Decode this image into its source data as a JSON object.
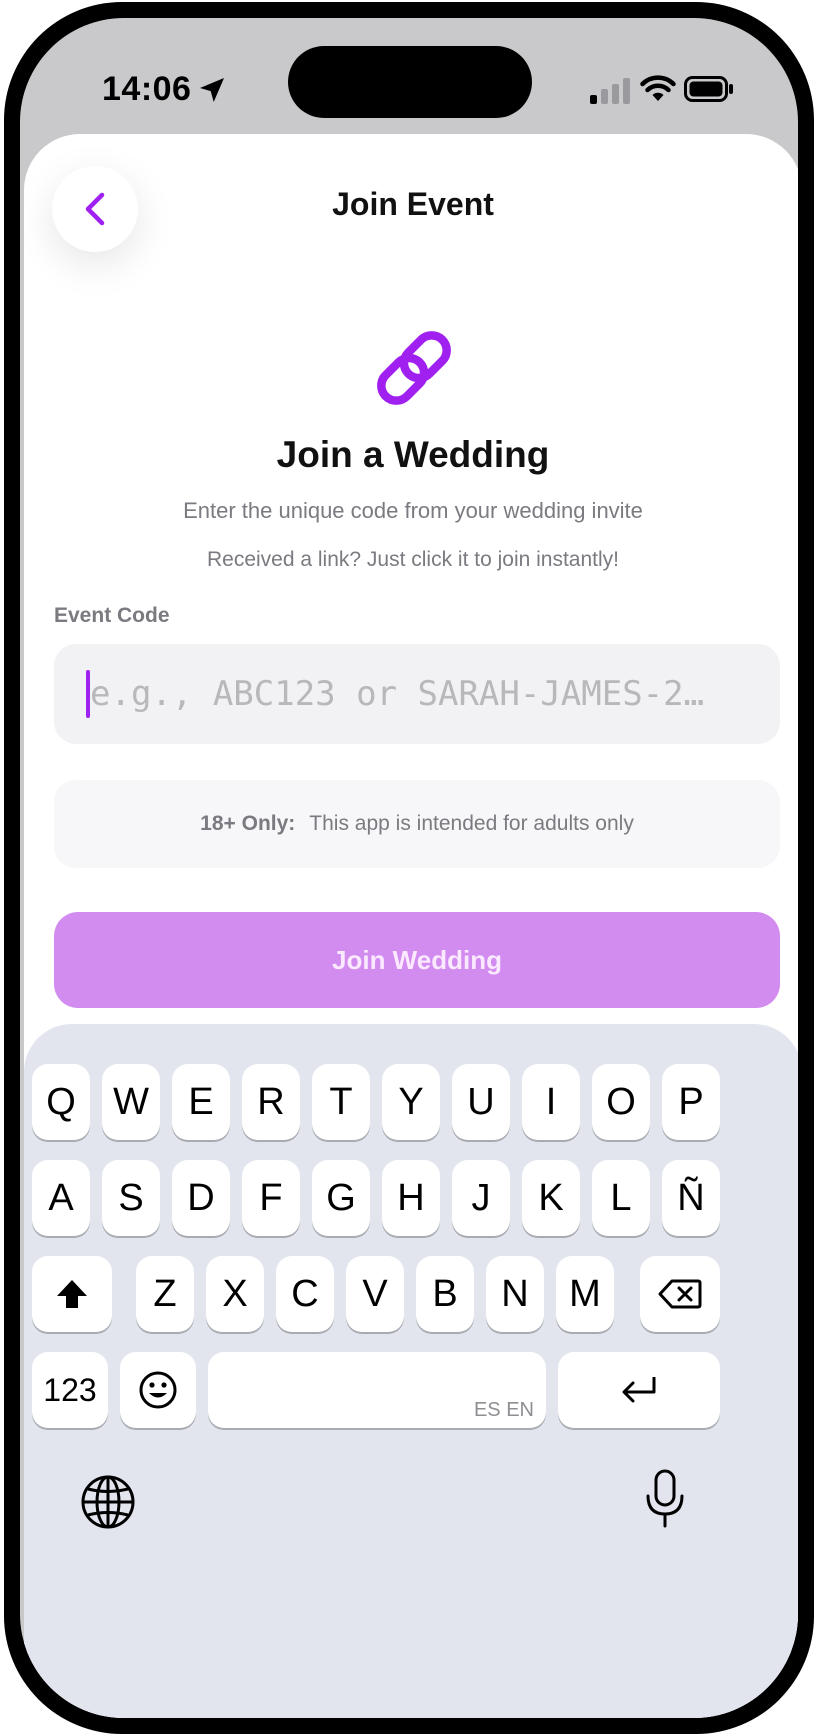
{
  "status": {
    "time": "14:06"
  },
  "nav": {
    "title": "Join Event"
  },
  "content": {
    "heading": "Join a Wedding",
    "subtitle": "Enter the unique code from your wedding invite",
    "hint": "Received a link? Just click it to join instantly!"
  },
  "form": {
    "label": "Event Code",
    "placeholder": "e.g., ABC123 or SARAH-JAMES-2…",
    "value": ""
  },
  "notice": {
    "strong": "18+ Only:",
    "text": "This app is intended for adults only"
  },
  "button": {
    "label": "Join Wedding"
  },
  "keyboard": {
    "row1": [
      "Q",
      "W",
      "E",
      "R",
      "T",
      "Y",
      "U",
      "I",
      "O",
      "P"
    ],
    "row2": [
      "A",
      "S",
      "D",
      "F",
      "G",
      "H",
      "J",
      "K",
      "L",
      "Ñ"
    ],
    "row3": [
      "Z",
      "X",
      "C",
      "V",
      "B",
      "N",
      "M"
    ],
    "numbers": "123",
    "language_hint": "ES EN"
  },
  "colors": {
    "accent": "#a020f0",
    "button_disabled": "#d28cf0"
  }
}
